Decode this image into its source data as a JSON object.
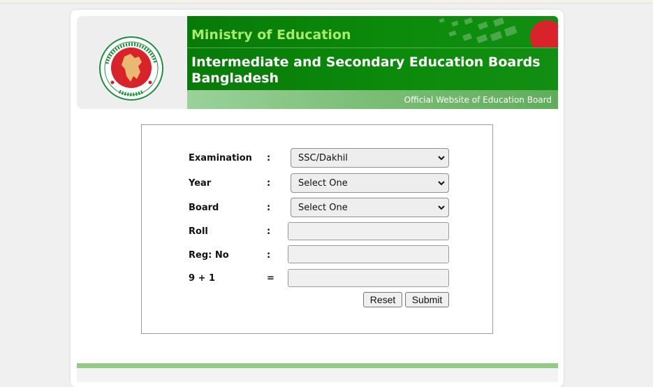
{
  "header": {
    "ministry": "Ministry of Education",
    "board_title": "Intermediate and Secondary Education Boards Bangladesh",
    "tagline": "Official Website of Education Board",
    "logo": "government-of-bangladesh-seal",
    "colors": {
      "banner_green": "#0b8a0b",
      "ministry_text": "#a6ec6c",
      "strip_green": "#7dbf78"
    }
  },
  "form": {
    "fields": [
      {
        "label": "Examination",
        "sep": ":",
        "type": "select",
        "value": "SSC/Dakhil"
      },
      {
        "label": "Year",
        "sep": ":",
        "type": "select",
        "value": "Select One"
      },
      {
        "label": "Board",
        "sep": ":",
        "type": "select",
        "value": "Select One"
      },
      {
        "label": "Roll",
        "sep": ":",
        "type": "input",
        "value": ""
      },
      {
        "label": "Reg: No",
        "sep": ":",
        "type": "input",
        "value": ""
      },
      {
        "label": "9 + 1",
        "sep": "=",
        "type": "input",
        "value": ""
      }
    ],
    "reset_label": "Reset",
    "submit_label": "Submit"
  }
}
